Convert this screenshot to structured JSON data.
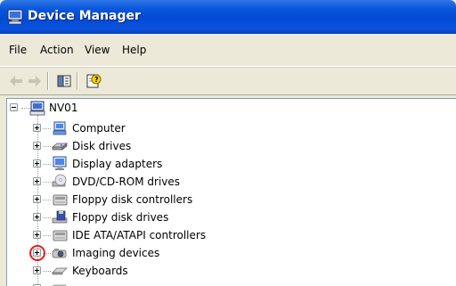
{
  "window": {
    "title": "Device Manager",
    "icon": "computer-icon"
  },
  "menu": [
    "File",
    "Action",
    "View",
    "Help"
  ],
  "toolbar": {
    "buttons": [
      "back-arrow-icon",
      "forward-arrow-icon",
      "properties-pane-icon",
      "help-icon"
    ]
  },
  "tree": {
    "root": {
      "label": "NV01",
      "icon": "computer-icon",
      "state": "expanded"
    },
    "items": [
      {
        "label": "Computer",
        "icon": "computer-icon"
      },
      {
        "label": "Disk drives",
        "icon": "disk-drive-icon"
      },
      {
        "label": "Display adapters",
        "icon": "monitor-icon"
      },
      {
        "label": "DVD/CD-ROM drives",
        "icon": "cd-drive-icon"
      },
      {
        "label": "Floppy disk controllers",
        "icon": "controller-icon"
      },
      {
        "label": "Floppy disk drives",
        "icon": "floppy-drive-icon"
      },
      {
        "label": "IDE ATA/ATAPI controllers",
        "icon": "controller-icon"
      },
      {
        "label": "Imaging devices",
        "icon": "camera-icon",
        "highlighted": true
      },
      {
        "label": "Keyboards",
        "icon": "keyboard-icon"
      }
    ]
  },
  "colors": {
    "titlebar": "#0a58dc",
    "highlight_circle": "#e02020"
  }
}
